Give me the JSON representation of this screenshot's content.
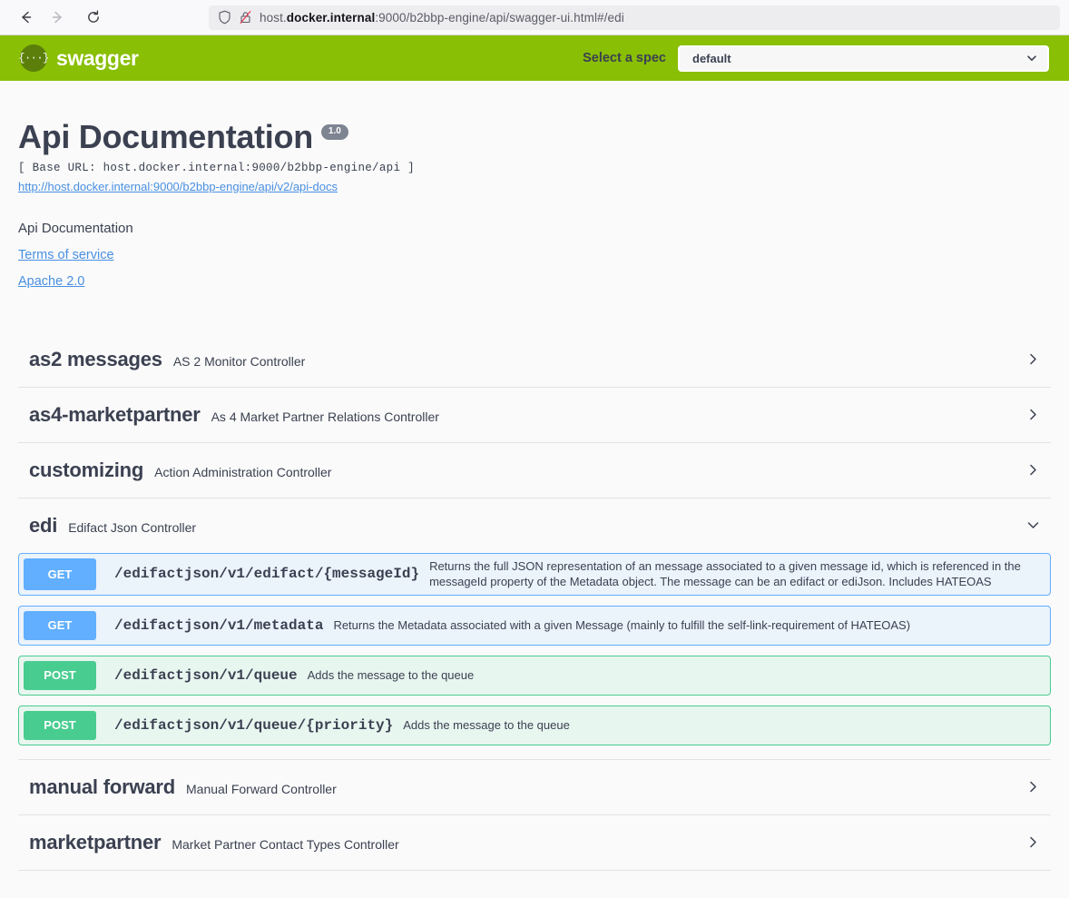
{
  "browser": {
    "back_icon": "arrow-left-icon",
    "forward_icon": "arrow-right-icon",
    "reload_icon": "reload-icon",
    "shield_icon": "shield-icon",
    "lock_broken_icon": "lock-broken-icon",
    "url_prefix": "host.",
    "url_host_strong": "docker.internal",
    "url_suffix": ":9000/b2bbp-engine/api/swagger-ui.html#/edi",
    "url_full": "host.docker.internal:9000/b2bbp-engine/api/swagger-ui.html#/edi"
  },
  "topbar": {
    "logo_mark": "{…}",
    "logo_text": "swagger",
    "spec_label": "Select a spec",
    "spec_selected": "default",
    "spec_options": [
      "default"
    ],
    "chevron_icon": "chevron-down-icon",
    "bg_color": "#89bf04"
  },
  "info": {
    "title": "Api Documentation",
    "version": "1.0",
    "base_url": "[ Base URL: host.docker.internal:9000/b2bbp-engine/api ]",
    "docs_link": "http://host.docker.internal:9000/b2bbp-engine/api/v2/api-docs",
    "description": "Api Documentation",
    "terms_link": "Terms of service",
    "license_link": "Apache 2.0"
  },
  "tags": [
    {
      "name": "as2 messages",
      "description": "AS 2 Monitor Controller",
      "expanded": false,
      "chevron_icon": "chevron-right-icon",
      "operations": []
    },
    {
      "name": "as4-marketpartner",
      "description": "As 4 Market Partner Relations Controller",
      "expanded": false,
      "chevron_icon": "chevron-right-icon",
      "operations": []
    },
    {
      "name": "customizing",
      "description": "Action Administration Controller",
      "expanded": false,
      "chevron_icon": "chevron-right-icon",
      "operations": []
    },
    {
      "name": "edi",
      "description": "Edifact Json Controller",
      "expanded": true,
      "chevron_icon": "chevron-down-icon",
      "operations": [
        {
          "method": "GET",
          "path": "/edifactjson/v1/edifact/{messageId}",
          "summary": "Returns the full JSON representation of an message associated to a given message id, which is referenced in the messageId property of the Metadata object. The message can be an edifact or ediJson. Includes HATEOAS",
          "color": "#61affe",
          "bg_color": "#ebf3fb"
        },
        {
          "method": "GET",
          "path": "/edifactjson/v1/metadata",
          "summary": "Returns the Metadata associated with a given Message (mainly to fulfill the self-link-requirement of HATEOAS)",
          "color": "#61affe",
          "bg_color": "#ebf3fb"
        },
        {
          "method": "POST",
          "path": "/edifactjson/v1/queue",
          "summary": "Adds the message to the queue",
          "color": "#49cc90",
          "bg_color": "#e8f6f0"
        },
        {
          "method": "POST",
          "path": "/edifactjson/v1/queue/{priority}",
          "summary": "Adds the message to the queue",
          "color": "#49cc90",
          "bg_color": "#e8f6f0"
        }
      ]
    },
    {
      "name": "manual forward",
      "description": "Manual Forward Controller",
      "expanded": false,
      "chevron_icon": "chevron-right-icon",
      "operations": []
    },
    {
      "name": "marketpartner",
      "description": "Market Partner Contact Types Controller",
      "expanded": false,
      "chevron_icon": "chevron-right-icon",
      "operations": []
    }
  ]
}
